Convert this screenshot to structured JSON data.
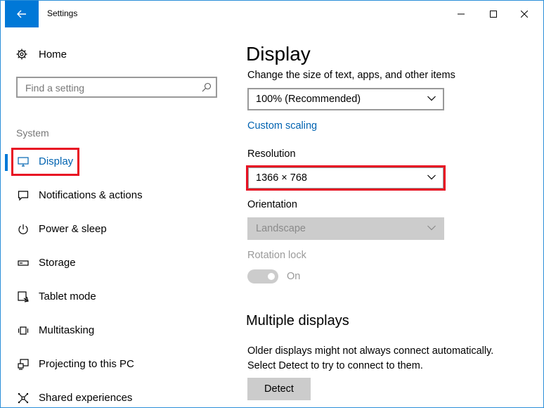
{
  "window": {
    "title": "Settings"
  },
  "sidebar": {
    "home_label": "Home",
    "search_placeholder": "Find a setting",
    "section_label": "System",
    "items": [
      {
        "label": "Display",
        "icon": "monitor-icon",
        "active": true
      },
      {
        "label": "Notifications & actions",
        "icon": "notification-icon"
      },
      {
        "label": "Power & sleep",
        "icon": "power-icon"
      },
      {
        "label": "Storage",
        "icon": "storage-icon"
      },
      {
        "label": "Tablet mode",
        "icon": "tablet-icon"
      },
      {
        "label": "Multitasking",
        "icon": "multitasking-icon"
      },
      {
        "label": "Projecting to this PC",
        "icon": "projecting-icon"
      },
      {
        "label": "Shared experiences",
        "icon": "shared-experiences-icon"
      }
    ]
  },
  "main": {
    "title": "Display",
    "scale_label": "Change the size of text, apps, and other items",
    "scale_value": "100% (Recommended)",
    "custom_scaling_link": "Custom scaling",
    "resolution_label": "Resolution",
    "resolution_value": "1366 × 768",
    "orientation_label": "Orientation",
    "orientation_value": "Landscape",
    "rotation_lock_label": "Rotation lock",
    "rotation_lock_state": "On",
    "multiple_displays_title": "Multiple displays",
    "multiple_displays_desc_1": "Older displays might not always connect automatically.",
    "multiple_displays_desc_2": "Select Detect to try to connect to them.",
    "detect_button": "Detect"
  },
  "colors": {
    "accent": "#0078d7",
    "link": "#0063b1",
    "highlight": "#e81123"
  }
}
